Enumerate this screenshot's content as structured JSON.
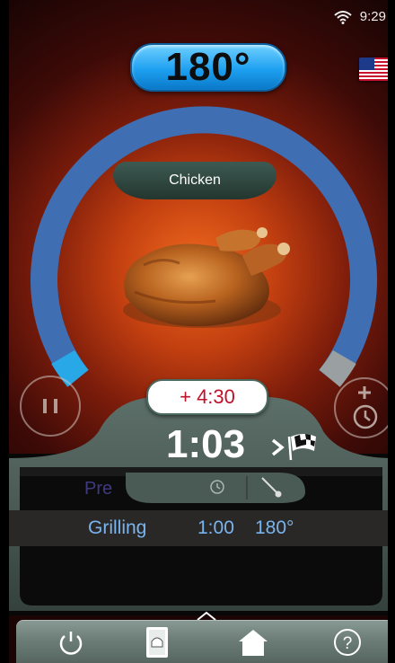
{
  "status": {
    "time": "9:29"
  },
  "temperature": "180°",
  "language_flag": "us-flag",
  "dish": {
    "label": "Chicken",
    "image": "roast-chicken-image"
  },
  "progress": {
    "fraction": 0.08
  },
  "add_time": "+ 4:30",
  "countdown": "1:03",
  "steps": {
    "previous_label": "Pre",
    "current": {
      "name": "Grilling",
      "time": "1:00",
      "temp": "180°"
    }
  },
  "icons": [
    "pause-icon",
    "add-timer-icon",
    "clock-icon",
    "probe-icon",
    "finish-flag-icon",
    "power-icon",
    "recipe-book-icon",
    "home-icon",
    "help-icon"
  ],
  "colors": {
    "accent_blue": "#3f6fb2",
    "progress_light": "#29a8e8",
    "temp_pill": "#1ea0f0",
    "step_text": "#7ab4ef",
    "add_time_text": "#c0112a"
  }
}
